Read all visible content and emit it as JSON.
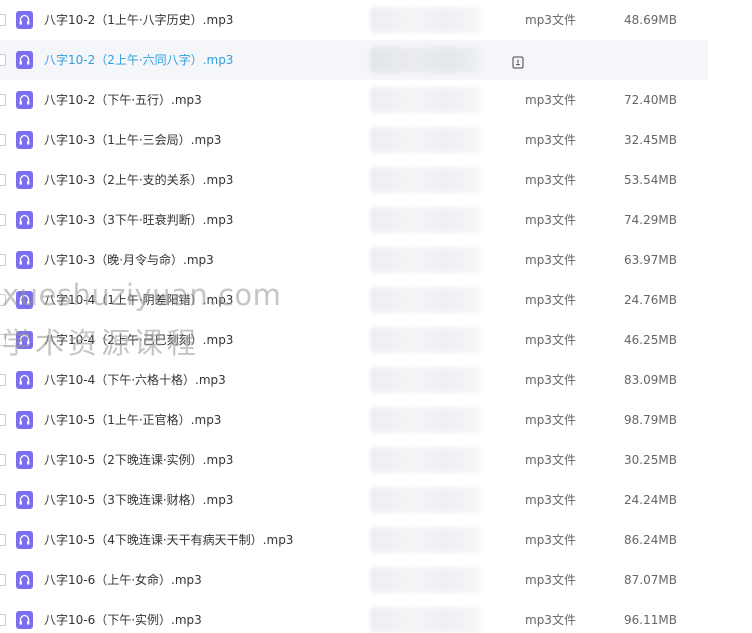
{
  "files": [
    {
      "name": "八字10-2（1上午·八字历史）.mp3",
      "type": "mp3文件",
      "size": "48.69MB"
    },
    {
      "name": "八字10-2（2上午·六同八字）.mp3",
      "type": "",
      "size": ""
    },
    {
      "name": "八字10-2（下午·五行）.mp3",
      "type": "mp3文件",
      "size": "72.40MB"
    },
    {
      "name": "八字10-3（1上午·三会局）.mp3",
      "type": "mp3文件",
      "size": "32.45MB"
    },
    {
      "name": "八字10-3（2上午·支的关系）.mp3",
      "type": "mp3文件",
      "size": "53.54MB"
    },
    {
      "name": "八字10-3（3下午·旺衰判断）.mp3",
      "type": "mp3文件",
      "size": "74.29MB"
    },
    {
      "name": "八字10-3（晚·月令与命）.mp3",
      "type": "mp3文件",
      "size": "63.97MB"
    },
    {
      "name": "八字10-4（1上午·阴差阳错）.mp3",
      "type": "mp3文件",
      "size": "24.76MB"
    },
    {
      "name": "八字10-4（2上午·己巳刻刻）.mp3",
      "type": "mp3文件",
      "size": "46.25MB"
    },
    {
      "name": "八字10-4（下午·六格十格）.mp3",
      "type": "mp3文件",
      "size": "83.09MB"
    },
    {
      "name": "八字10-5（1上午·正官格）.mp3",
      "type": "mp3文件",
      "size": "98.79MB"
    },
    {
      "name": "八字10-5（2下晚连课·实例）.mp3",
      "type": "mp3文件",
      "size": "30.25MB"
    },
    {
      "name": "八字10-5（3下晚连课·财格）.mp3",
      "type": "mp3文件",
      "size": "24.24MB"
    },
    {
      "name": "八字10-5（4下晚连课·天干有病天干制）.mp3",
      "type": "mp3文件",
      "size": "86.24MB"
    },
    {
      "name": "八字10-6（上午·女命）.mp3",
      "type": "mp3文件",
      "size": "87.07MB"
    },
    {
      "name": "八字10-6（下午·实例）.mp3",
      "type": "mp3文件",
      "size": "96.11MB"
    }
  ],
  "hover_index": 1,
  "watermark": {
    "line1": "xueshuziyuan.com",
    "line2": "学术资源课程"
  },
  "colors": {
    "icon_purple": "#7b6ff0",
    "hover_text": "#2f9fde"
  }
}
